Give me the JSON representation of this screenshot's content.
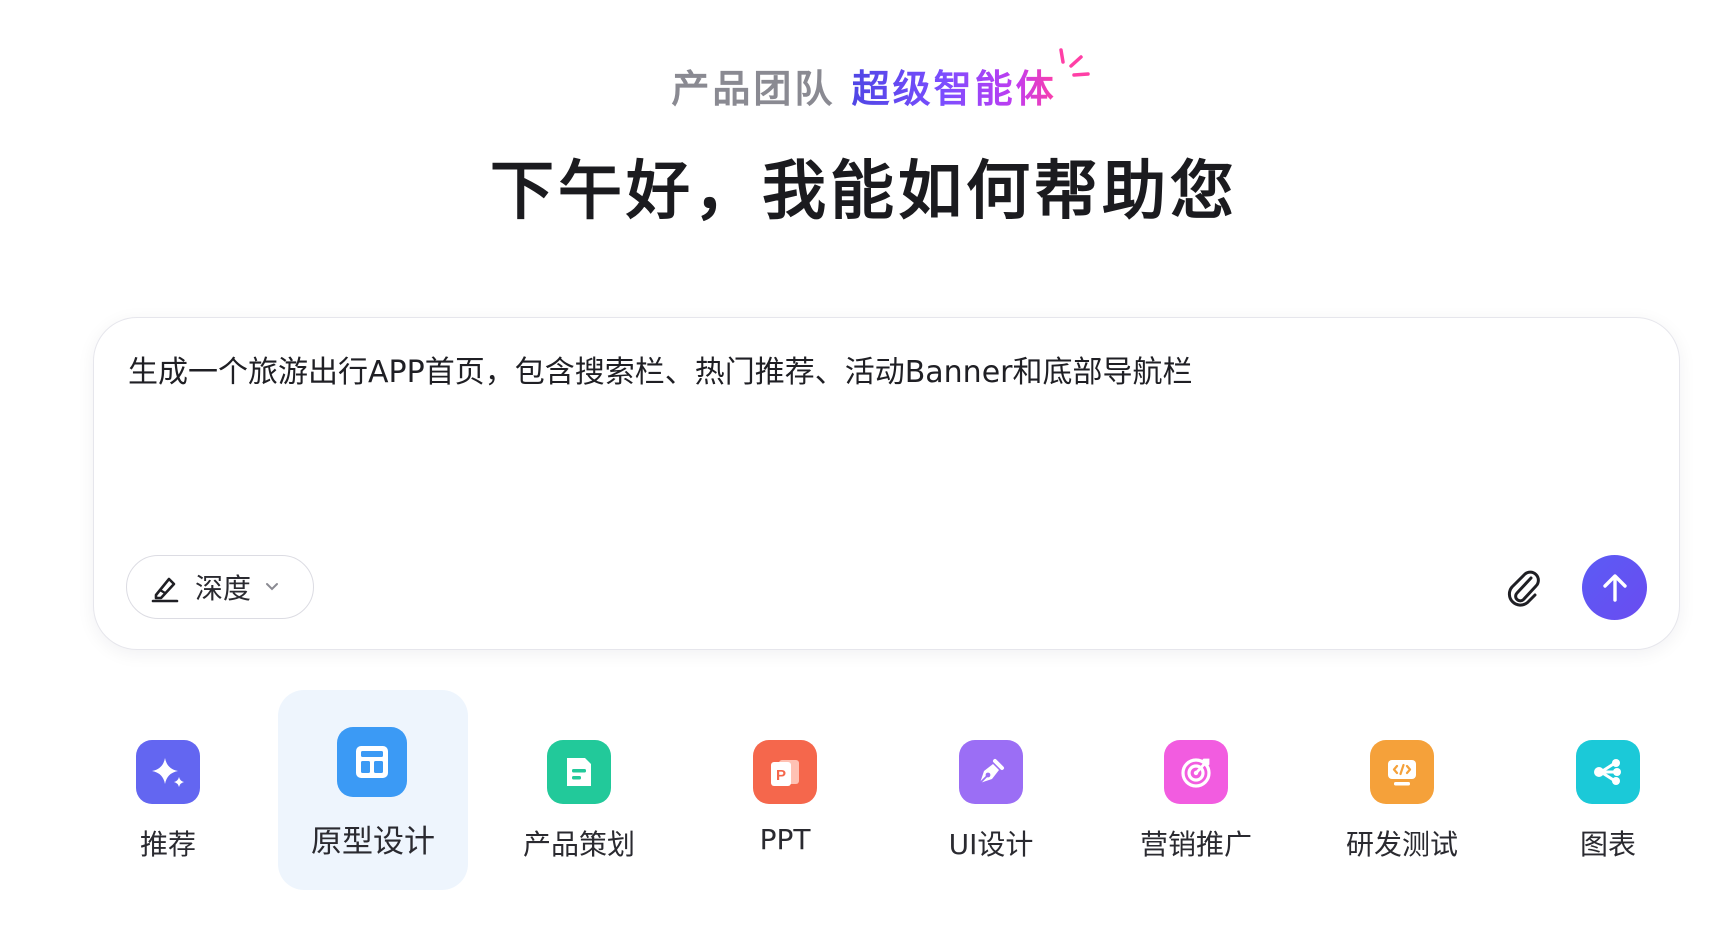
{
  "tagline": {
    "prefix": "产品团队",
    "highlight": "超级智能体"
  },
  "greeting": "下午好，我能如何帮助您",
  "composer": {
    "prompt_text": "生成一个旅游出行APP首页，包含搜索栏、热门推荐、活动Banner和底部导航栏",
    "mode_label": "深度",
    "icons": {
      "mode": "pen-sparkle-icon",
      "attach": "paperclip-icon",
      "send": "arrow-up-icon"
    },
    "send_color": "#5b5bf5"
  },
  "categories": [
    {
      "label": "推荐",
      "icon": "sparkle-icon",
      "color": "#6366f1",
      "active": false
    },
    {
      "label": "原型设计",
      "icon": "layout-icon",
      "color": "#3b9af5",
      "active": true
    },
    {
      "label": "产品策划",
      "icon": "document-icon",
      "color": "#22c99a",
      "active": false
    },
    {
      "label": "PPT",
      "icon": "ppt-icon",
      "color": "#f5674c",
      "active": false
    },
    {
      "label": "UI设计",
      "icon": "pen-nib-icon",
      "color": "#9b6ef5",
      "active": false
    },
    {
      "label": "营销推广",
      "icon": "target-icon",
      "color": "#f25ce0",
      "active": false
    },
    {
      "label": "研发测试",
      "icon": "code-monitor-icon",
      "color": "#f5a13a",
      "active": false
    },
    {
      "label": "图表",
      "icon": "share-nodes-icon",
      "color": "#1bc9d8",
      "active": false
    }
  ]
}
